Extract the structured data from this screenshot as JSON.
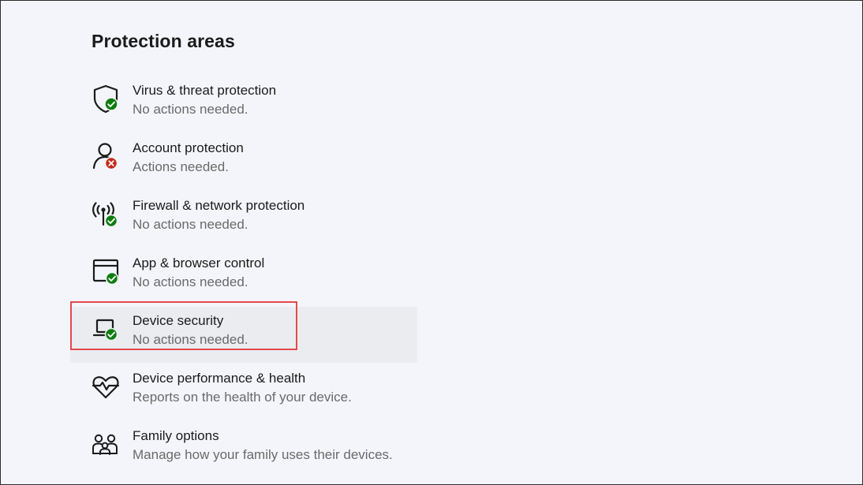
{
  "section": {
    "title": "Protection areas"
  },
  "areas": [
    {
      "title": "Virus & threat protection",
      "status": "No actions needed.",
      "icon": "shield-icon",
      "badge": "ok"
    },
    {
      "title": "Account protection",
      "status": "Actions needed.",
      "icon": "person-icon",
      "badge": "error"
    },
    {
      "title": "Firewall & network protection",
      "status": "No actions needed.",
      "icon": "antenna-icon",
      "badge": "ok"
    },
    {
      "title": "App & browser control",
      "status": "No actions needed.",
      "icon": "browser-window-icon",
      "badge": "ok"
    },
    {
      "title": "Device security",
      "status": "No actions needed.",
      "icon": "laptop-icon",
      "badge": "ok"
    },
    {
      "title": "Device performance & health",
      "status": "Reports on the health of your device.",
      "icon": "heart-pulse-icon",
      "badge": "none"
    },
    {
      "title": "Family options",
      "status": "Manage how your family uses their devices.",
      "icon": "family-icon",
      "badge": "none"
    }
  ],
  "colors": {
    "ok_badge": "#107c10",
    "error_badge": "#c42b1c",
    "highlight_border": "#e5484d",
    "hover_background": "#eaecf0"
  }
}
